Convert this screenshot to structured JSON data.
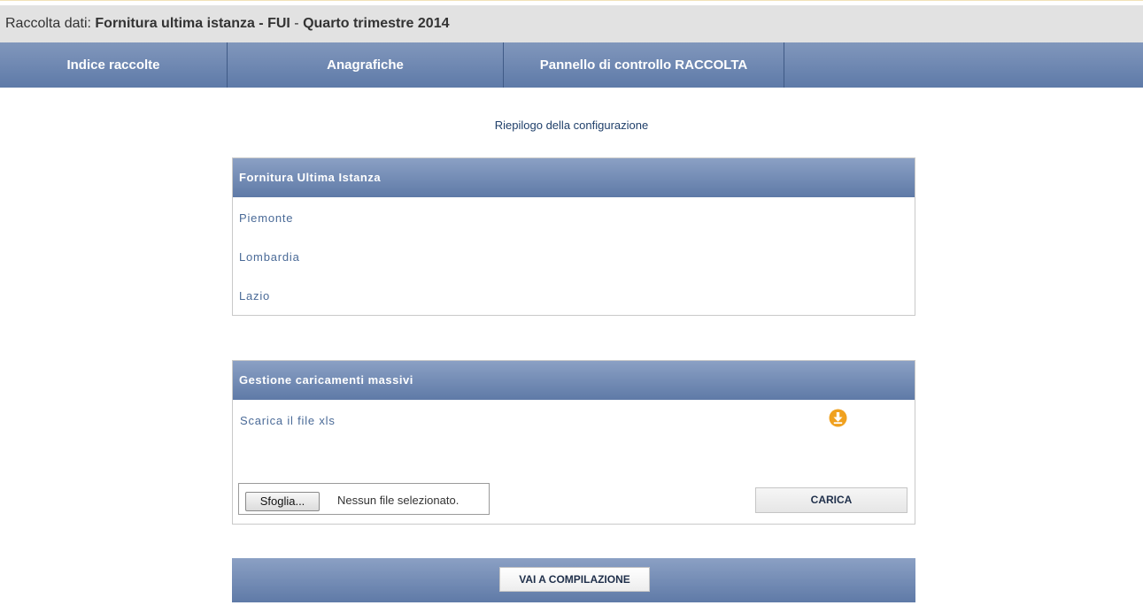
{
  "header": {
    "prefix": "Raccolta dati: ",
    "title": "Fornitura ultima istanza - FUI",
    "separator": " - ",
    "period": "Quarto trimestre 2014"
  },
  "nav": {
    "items": [
      {
        "label": "Indice raccolte"
      },
      {
        "label": "Anagrafiche"
      },
      {
        "label": "Pannello di controllo RACCOLTA"
      }
    ]
  },
  "config_link": "Riepilogo della configurazione",
  "supply_panel": {
    "title": "Fornitura Ultima Istanza",
    "regions": [
      "Piemonte",
      "Lombardia",
      "Lazio"
    ]
  },
  "bulk_panel": {
    "title": "Gestione caricamenti massivi",
    "download_label": "Scarica il file xls",
    "download_icon": "download-circle-icon",
    "browse_label": "Sfoglia...",
    "file_status": "Nessun file selezionato.",
    "upload_label": "CARICA"
  },
  "footer": {
    "compile_label": "VAI A COMPILAZIONE"
  },
  "colors": {
    "header_bg": "#e2e2e2",
    "nav_bg": "#6e87b2",
    "panel_header_bg": "#7690ba",
    "link": "#4a6a97",
    "download_icon": "#f0a11f"
  }
}
